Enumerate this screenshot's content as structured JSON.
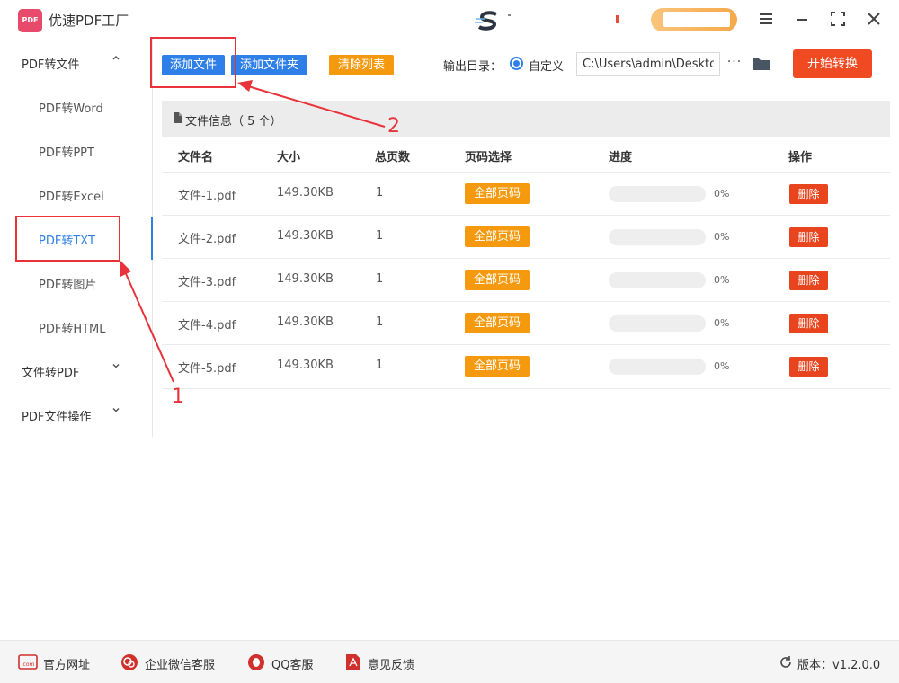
{
  "app": {
    "title": "优速PDF工厂",
    "logo_text": "PDF"
  },
  "sidebar": {
    "groups": [
      {
        "label": "PDF转文件",
        "expanded": true
      },
      {
        "label": "文件转PDF",
        "expanded": false
      },
      {
        "label": "PDF文件操作",
        "expanded": false
      }
    ],
    "items": [
      {
        "label": "PDF转Word"
      },
      {
        "label": "PDF转PPT"
      },
      {
        "label": "PDF转Excel"
      },
      {
        "label": "PDF转TXT",
        "active": true
      },
      {
        "label": "PDF转图片"
      },
      {
        "label": "PDF转HTML"
      }
    ]
  },
  "toolbar": {
    "add_file_label": "添加文件",
    "add_folder_label": "添加文件夹",
    "clear_list_label": "清除列表",
    "output_dir_label": "输出目录：",
    "custom_radio_label": "自定义",
    "output_path": "C:\\Users\\admin\\Deskto",
    "more_label": "···",
    "start_label": "开始转换"
  },
  "panel": {
    "title": "文件信息（ 5 个）",
    "columns": [
      "文件名",
      "大小",
      "总页数",
      "页码选择",
      "进度",
      "操作"
    ],
    "rows": [
      {
        "name": "文件-1.pdf",
        "size": "149.30KB",
        "pages": "1",
        "page_select": "全部页码",
        "progress": 0,
        "progress_text": "0%",
        "action": "删除"
      },
      {
        "name": "文件-2.pdf",
        "size": "149.30KB",
        "pages": "1",
        "page_select": "全部页码",
        "progress": 0,
        "progress_text": "0%",
        "action": "删除"
      },
      {
        "name": "文件-3.pdf",
        "size": "149.30KB",
        "pages": "1",
        "page_select": "全部页码",
        "progress": 0,
        "progress_text": "0%",
        "action": "删除"
      },
      {
        "name": "文件-4.pdf",
        "size": "149.30KB",
        "pages": "1",
        "page_select": "全部页码",
        "progress": 0,
        "progress_text": "0%",
        "action": "删除"
      },
      {
        "name": "文件-5.pdf",
        "size": "149.30KB",
        "pages": "1",
        "page_select": "全部页码",
        "progress": 0,
        "progress_text": "0%",
        "action": "删除"
      }
    ]
  },
  "footer": {
    "website_label": "官方网址",
    "website_icon_text": ".com",
    "wechat_label": "企业微信客服",
    "qq_label": "QQ客服",
    "feedback_label": "意见反馈",
    "version_label": "版本：v1.2.0.0"
  },
  "annotations": {
    "label_1": "1",
    "label_2": "2"
  },
  "colors": {
    "accent_blue": "#2f7fe8",
    "orange": "#f59a0e",
    "red": "#e8451e",
    "annotation_red": "#e8333a"
  }
}
